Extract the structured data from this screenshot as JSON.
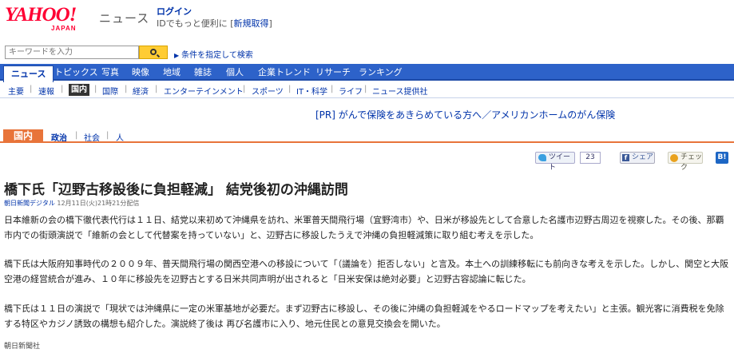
{
  "header": {
    "logo_text": "YAHOO!",
    "logo_sub": "JAPAN",
    "service_name": "ニュース",
    "login_label": "ログイン",
    "id_text": "IDでもっと便利に",
    "new_account_label": "新規取得",
    "bracket_open": "[",
    "bracket_close": "]"
  },
  "search": {
    "placeholder": "キーワードを入力",
    "condition_label": "条件を指定して検索"
  },
  "nav": {
    "items": [
      "ニュース",
      "トピックス",
      "写真",
      "映像",
      "地域",
      "雑誌",
      "個人",
      "企業トレンド",
      "リサーチ",
      "ランキング"
    ],
    "active": "ニュース"
  },
  "subnav": {
    "items": [
      "主要",
      "速報",
      "国内",
      "国際",
      "経済",
      "エンターテインメント",
      "スポーツ",
      "IT・科学",
      "ライフ",
      "ニュース提供社"
    ],
    "active": "国内"
  },
  "pr": {
    "text": "[PR] がんで保険をあきらめている方へ／アメリカンホームのがん保険"
  },
  "section": {
    "label": "国内",
    "items": [
      "政治",
      "社会",
      "人"
    ]
  },
  "share": {
    "tweet_label": "ツイート",
    "tweet_count": "23",
    "facebook_label": "シェア",
    "mixi_label": "チェック",
    "hatena_label": "B!"
  },
  "article": {
    "title": "橋下氏「辺野古移設後に負担軽減」 結党後初の沖縄訪問",
    "source": "朝日新聞デジタル",
    "timestamp": "12月11日(火)21時21分配信",
    "paragraphs": [
      "日本維新の会の橋下徹代表代行は１１日、結党以来初めて沖縄県を訪れ、米軍普天間飛行場（宜野湾市）や、日米が移設先として合意した名護市辺野古周辺を視察した。その後、那覇市内での街頭演説で「維新の会として代替案を持っていない」と、辺野古に移設したうえで沖縄の負担軽減策に取り組む考えを示した。",
      "橋下氏は大阪府知事時代の２００９年、普天間飛行場の関西空港への移設について「（議論を）拒否しない」と言及。本土への訓練移転にも前向きな考えを示した。しかし、関空と大阪空港の経営統合が進み、１０年に移設先を辺野古とする日米共同声明が出されると「日米安保は絶対必要」と辺野古容認論に転じた。",
      "橋下氏は１１日の演説で「現状では沖縄県に一定の米軍基地が必要だ。まず辺野古に移設し、その後に沖縄の負担軽減をやるロードマップを考えたい」と主張。観光客に消費税を免除する特区やカジノ誘致の構想も紹介した。演説終了後は 再び名護市に入り、地元住民との意見交換会を開いた。"
    ],
    "credit": "朝日新聞社"
  },
  "colors": {
    "nav_blue": "#2d62c9",
    "section_orange": "#e8743a",
    "link_blue": "#0033aa",
    "yahoo_red": "#ff0033",
    "search_button": "#ffcc33"
  }
}
